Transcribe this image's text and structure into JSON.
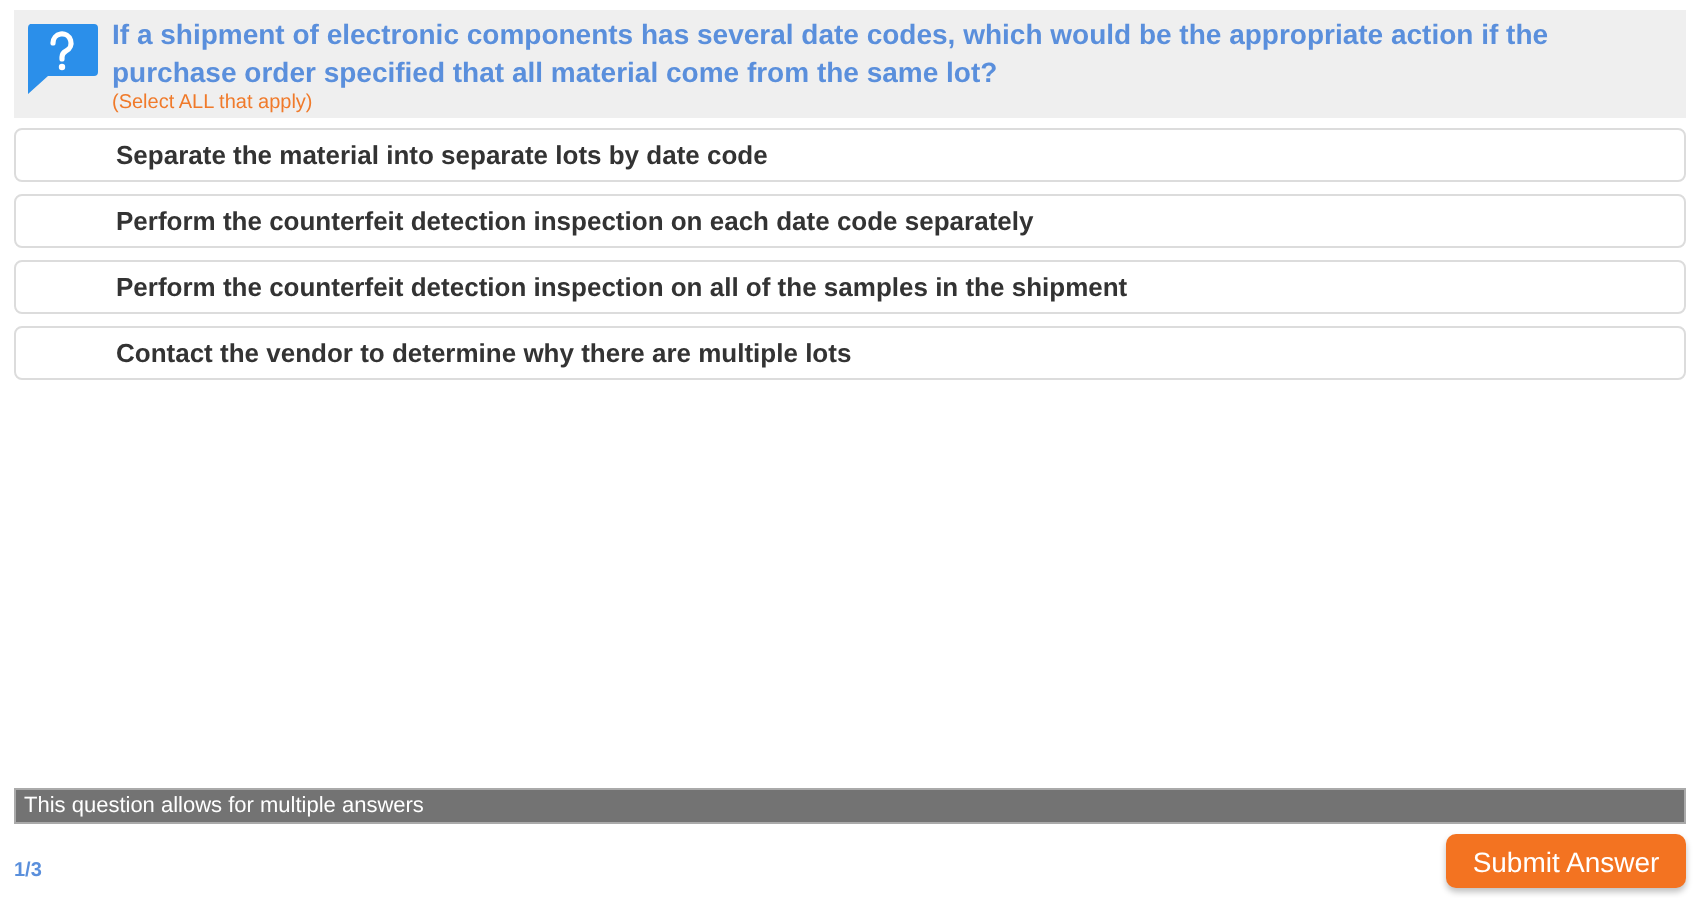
{
  "question": {
    "text": "If a shipment of electronic components has several date codes, which would be the appropriate action if the purchase order specified that all material come from the same lot?",
    "instruction": "(Select ALL that apply)"
  },
  "options": [
    {
      "label": "Separate the material into separate lots by date code"
    },
    {
      "label": "Perform the counterfeit detection inspection on each date code separately"
    },
    {
      "label": "Perform the counterfeit detection inspection on all of the samples in the shipment"
    },
    {
      "label": "Contact the vendor to determine why there are multiple lots"
    }
  ],
  "notice": "This question allows for multiple answers",
  "progress": "1/3",
  "submit_button": "Submit Answer"
}
